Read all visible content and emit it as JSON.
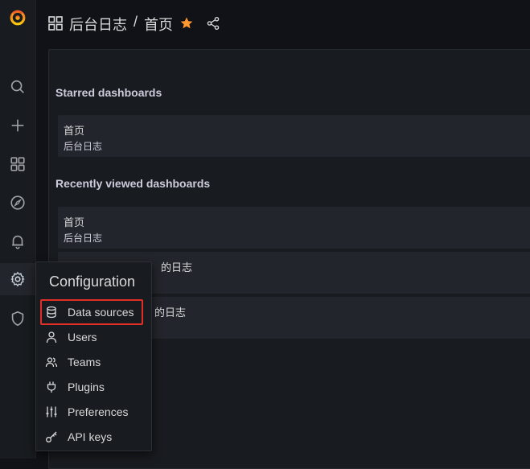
{
  "breadcrumb": {
    "folder": "后台日志",
    "separator": "/",
    "title": "首页"
  },
  "sections": {
    "starred_title": "Starred dashboards",
    "recent_title": "Recently viewed dashboards"
  },
  "starred": [
    {
      "name": "首页",
      "folder": "后台日志"
    }
  ],
  "recent": [
    {
      "name": "首页",
      "folder": "后台日志"
    },
    {
      "name": "的日志",
      "folder": ""
    },
    {
      "name": "的日志",
      "folder": ""
    }
  ],
  "config_menu": {
    "title": "Configuration",
    "items": [
      {
        "label": "Data sources",
        "icon": "database-icon"
      },
      {
        "label": "Users",
        "icon": "user-icon"
      },
      {
        "label": "Teams",
        "icon": "users-icon"
      },
      {
        "label": "Plugins",
        "icon": "plug-icon"
      },
      {
        "label": "Preferences",
        "icon": "sliders-icon"
      },
      {
        "label": "API keys",
        "icon": "key-icon"
      }
    ]
  },
  "colors": {
    "accent": "#ff9830",
    "highlight": "#e02f27",
    "background": "#111217"
  }
}
